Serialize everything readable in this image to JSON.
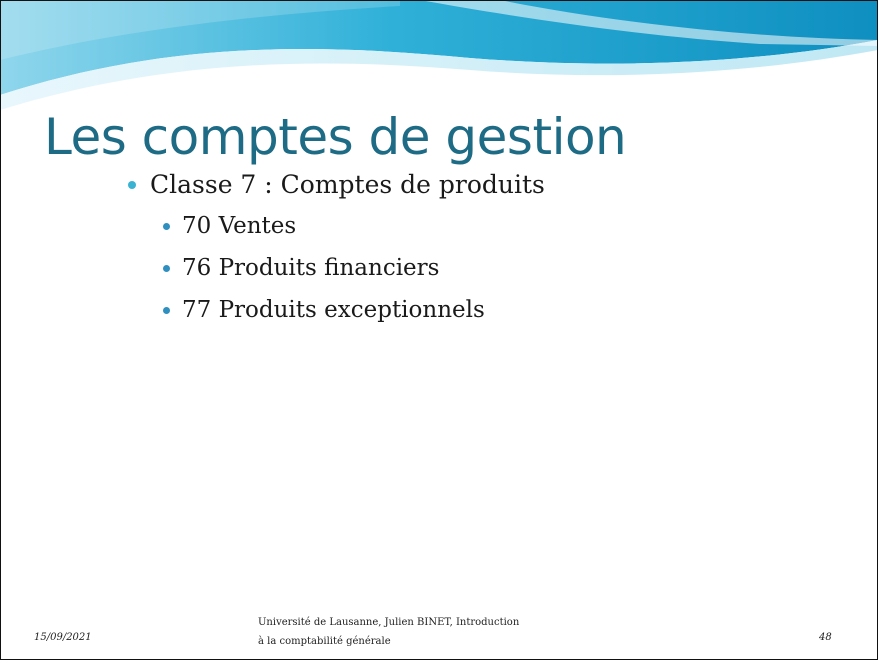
{
  "slide": {
    "title": "Les comptes de gestion",
    "level1": "Classe 7 : Comptes de produits",
    "items": [
      "70 Ventes",
      "76 Produits financiers",
      "77 Produits exceptionnels"
    ]
  },
  "footer": {
    "date": "15/09/2021",
    "center_line1": "Université de Lausanne, Julien BINET, Introduction",
    "center_line2": "à la comptabilité générale",
    "page": "48"
  },
  "colors": {
    "title": "#1e6b86",
    "bullet": "#3ab3d3",
    "wave_dark": "#1a9fcc",
    "wave_light": "#bfe8f4"
  }
}
